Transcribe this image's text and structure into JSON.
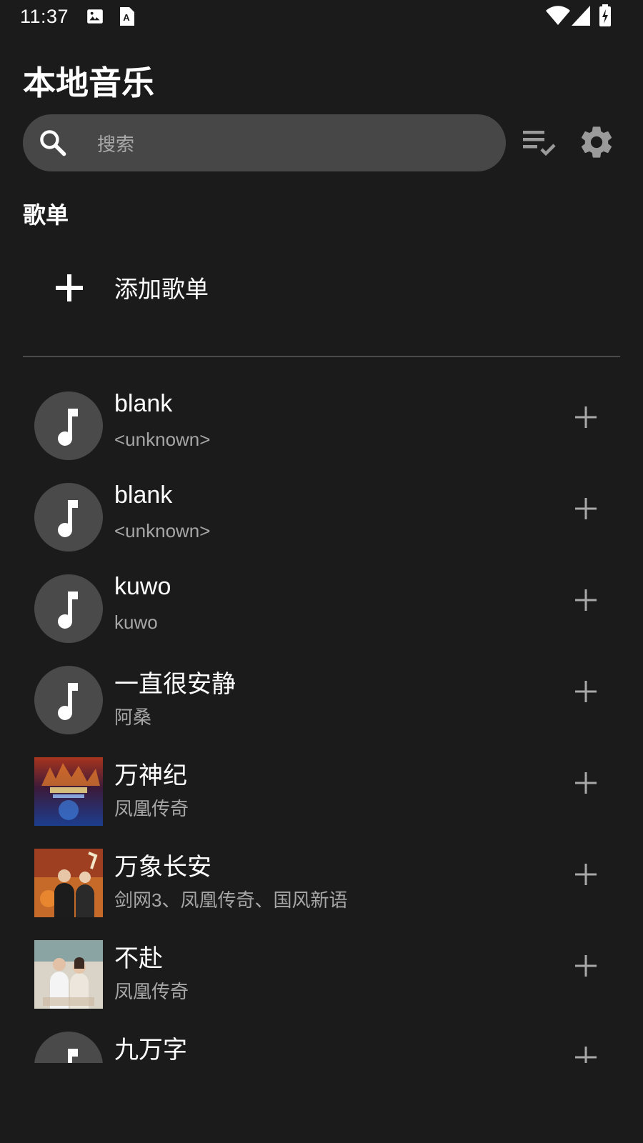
{
  "status_bar": {
    "time": "11:37"
  },
  "header": {
    "title": "本地音乐"
  },
  "search": {
    "placeholder": "搜索"
  },
  "section": {
    "title": "歌单",
    "add_playlist_label": "添加歌单"
  },
  "songs": [
    {
      "title": "blank",
      "artist": "<unknown>",
      "cover": "music-note"
    },
    {
      "title": "blank",
      "artist": "<unknown>",
      "cover": "music-note"
    },
    {
      "title": "kuwo",
      "artist": "kuwo",
      "cover": "music-note"
    },
    {
      "title": "一直很安静",
      "artist": "阿桑",
      "cover": "music-note"
    },
    {
      "title": "万神纪",
      "artist": "凤凰传奇",
      "cover": "album-art"
    },
    {
      "title": "万象长安",
      "artist": "剑网3、凤凰传奇、国风新语",
      "cover": "album-art"
    },
    {
      "title": "不赴",
      "artist": "凤凰传奇",
      "cover": "album-art"
    },
    {
      "title": "九万字",
      "artist": "",
      "cover": "music-note"
    }
  ],
  "colors": {
    "background": "#1b1b1b",
    "search_bg": "#474747",
    "secondary_text": "#a6a6a6",
    "icon_gray": "#9a9a9a"
  }
}
